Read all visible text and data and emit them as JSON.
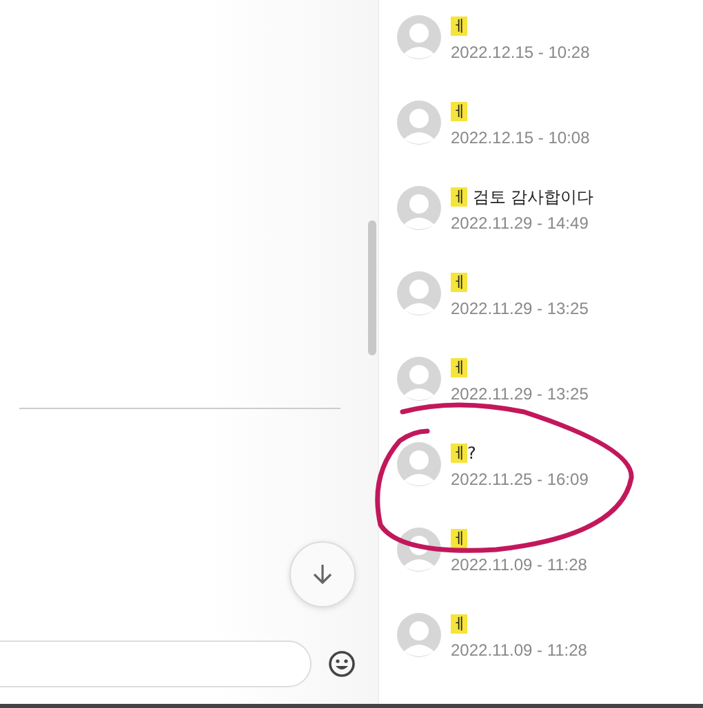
{
  "comments": [
    {
      "highlight": "ㅔ",
      "date": "2022.12.15 - 10:28"
    },
    {
      "highlight": "ㅔ",
      "date": "2022.12.15 - 10:08"
    },
    {
      "highlight": "ㅔ",
      "text": " 검토 감사합이다",
      "date": "2022.11.29 - 14:49"
    },
    {
      "highlight": "ㅔ",
      "date": "2022.11.29 - 13:25"
    },
    {
      "highlight": "ㅔ",
      "date": "2022.11.29 - 13:25"
    },
    {
      "highlight": "ㅔ",
      "text": "?",
      "date": "2022.11.25 - 16:09"
    },
    {
      "highlight": "ㅔ",
      "date": "2022.11.09 - 11:28"
    },
    {
      "highlight": "ㅔ",
      "date": "2022.11.09 - 11:28"
    }
  ]
}
